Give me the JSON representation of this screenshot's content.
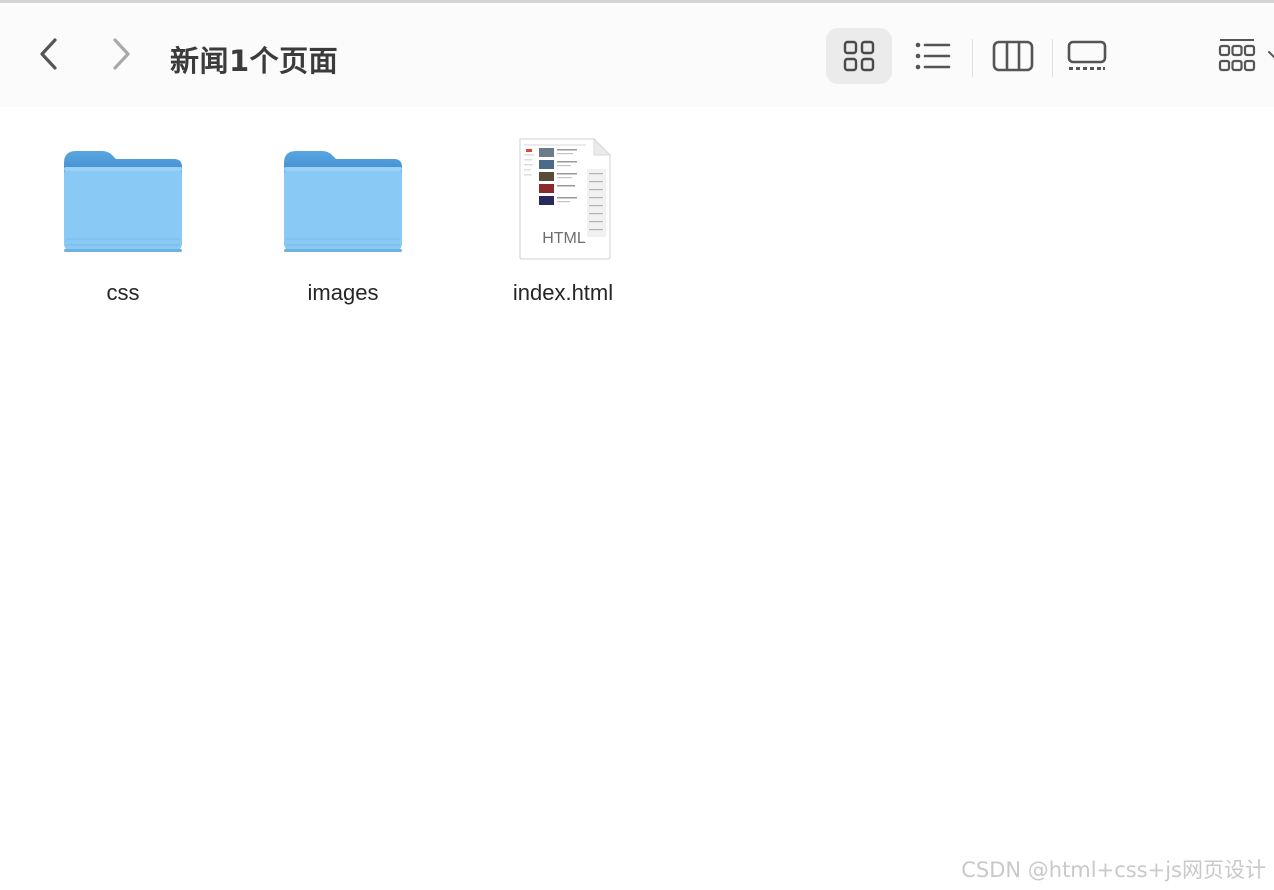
{
  "window": {
    "title": "新闻1个页面"
  },
  "toolbar": {
    "back_icon": "chevron-left-icon",
    "forward_icon": "chevron-right-icon",
    "views": [
      {
        "name": "icon-view",
        "icon": "grid-icon",
        "selected": true
      },
      {
        "name": "list-view",
        "icon": "list-icon",
        "selected": false
      },
      {
        "name": "column-view",
        "icon": "columns-icon",
        "selected": false
      },
      {
        "name": "gallery-view",
        "icon": "gallery-icon",
        "selected": false
      },
      {
        "name": "group-view",
        "icon": "group-grid-icon",
        "selected": false
      }
    ]
  },
  "files": [
    {
      "name": "css",
      "kind": "folder",
      "icon": "folder-icon"
    },
    {
      "name": "images",
      "kind": "folder",
      "icon": "folder-icon"
    },
    {
      "name": "index.html",
      "kind": "html-file",
      "icon": "html-file-icon",
      "badge": "HTML"
    }
  ],
  "colors": {
    "folder_front": "#89c9f5",
    "folder_back": "#4f98d6",
    "toolbar_bg": "#fbfbfb",
    "selected_view_bg": "#ebebeb",
    "icon_gray": "#5c5c5c"
  },
  "watermark": "CSDN @html+css+js网页设计"
}
